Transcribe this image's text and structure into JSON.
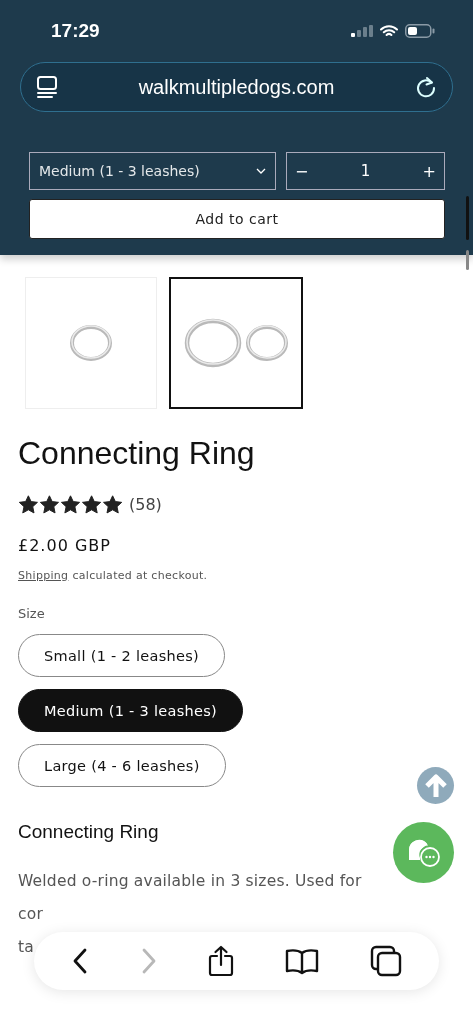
{
  "status_bar": {
    "time": "17:29"
  },
  "address_bar": {
    "url": "walkmultipledogs.com"
  },
  "sticky_cart": {
    "variant": "Medium (1 - 3 leashes)",
    "quantity_minus": "−",
    "quantity": "1",
    "quantity_plus": "+",
    "add_to_cart": "Add to cart"
  },
  "thumbnails": [
    {
      "kind": "picture",
      "selected": false
    },
    {
      "kind": "picture",
      "selected": true
    }
  ],
  "product": {
    "title": "Connecting Ring",
    "stars": 5,
    "review_count": "(58)",
    "price": "£2.00 GBP",
    "shipping_link": "Shipping",
    "shipping_text": "calculated at checkout."
  },
  "size_label": "Size",
  "size_options": [
    {
      "label": "Small (1 - 2 leashes)",
      "selected": false
    },
    {
      "label": "Medium (1 - 3 leashes)",
      "selected": true
    },
    {
      "label": "Large (4 - 6 leashes)",
      "selected": false
    }
  ],
  "description": {
    "heading": "Connecting Ring",
    "lines": [
      "Welded o-ring available in 3 sizes. Used for",
      "cor",
      "ta"
    ]
  },
  "toolbar": [
    {
      "kind": "back",
      "disabled": false
    },
    {
      "kind": "forward",
      "disabled": true
    },
    {
      "kind": "share",
      "disabled": false
    },
    {
      "kind": "bookmarks",
      "disabled": false
    },
    {
      "kind": "tabs",
      "disabled": false
    }
  ]
}
